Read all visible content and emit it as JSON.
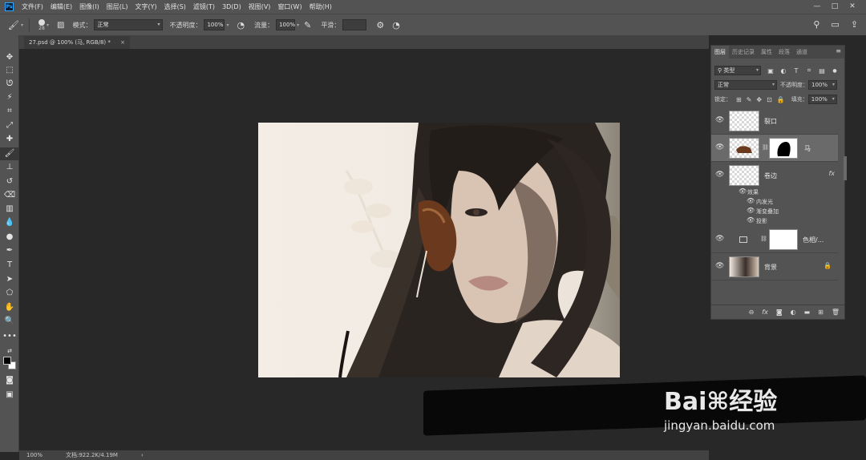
{
  "menubar": {
    "logo": "Ps",
    "items": [
      "文件(F)",
      "编辑(E)",
      "图像(I)",
      "图层(L)",
      "文字(Y)",
      "选择(S)",
      "滤镜(T)",
      "3D(D)",
      "视图(V)",
      "窗口(W)",
      "帮助(H)"
    ],
    "window_controls": [
      "—",
      "□",
      "✕"
    ]
  },
  "options": {
    "brush_size": "28",
    "mode_label": "模式：",
    "mode_value": "正常",
    "opacity_label": "不透明度：",
    "opacity_value": "100%",
    "flow_label": "流量：",
    "flow_value": "100%",
    "smoothing_label": "平滑：",
    "smoothing_value": ""
  },
  "document": {
    "tab_title": "27.psd @ 100% (马, RGB/8) *",
    "close": "×"
  },
  "status": {
    "zoom": "100%",
    "doc_info": "文档:922.2K/4.19M",
    "arrow": "›"
  },
  "layers_panel": {
    "tabs": [
      "图层",
      "历史记录",
      "属性",
      "段落",
      "通道"
    ],
    "active_tab": "图层",
    "filter_value": "类型",
    "blend_mode": "正常",
    "opacity_label": "不透明度：",
    "opacity_value": "100%",
    "lock_label": "锁定：",
    "fill_label": "填充：",
    "fill_value": "100%",
    "layers": [
      {
        "name": "裂口"
      },
      {
        "name": "马"
      },
      {
        "name": "卷边",
        "fx": "fx"
      },
      {
        "name": "色相/..."
      },
      {
        "name": "背景"
      }
    ],
    "effects_label": "效果",
    "effects": [
      "内发光",
      "渐变叠加",
      "投影"
    ]
  },
  "watermark": {
    "logo": "Bai⌘经验",
    "url": "jingyan.baidu.com"
  },
  "colors": {
    "ui_dark": "#535353",
    "canvas_bg": "#282828",
    "accent": "#31a8ff"
  }
}
